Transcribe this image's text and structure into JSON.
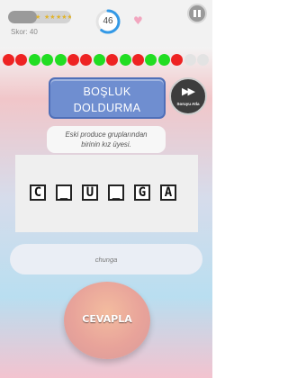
{
  "header": {
    "stars_fraction": 0.45,
    "score_text": "Skor: 40",
    "timer_value": "46",
    "timer_fraction": 0.6,
    "star_labels": [
      "★",
      "★★",
      "★★★"
    ],
    "heart_icon": "♥"
  },
  "progress": {
    "states": [
      "red",
      "red",
      "green",
      "green",
      "green",
      "red",
      "red",
      "green",
      "red",
      "green",
      "red",
      "green",
      "green",
      "red",
      "gray",
      "gray"
    ],
    "colors": {
      "red": "#ee2222",
      "green": "#22dd22",
      "gray": "#e3e3e3"
    }
  },
  "category": {
    "line1": "BOŞLUK",
    "line2": "DOLDURMA"
  },
  "skip_button": {
    "icon": "▶▶",
    "label": "Soruyu Atla"
  },
  "hint": {
    "line1": "Eski produce gruplarından",
    "line2": "birinin kız üyesi."
  },
  "puzzle": {
    "tiles": [
      "C",
      "_",
      "U",
      "_",
      "G",
      "A"
    ]
  },
  "answer": {
    "value": "chunga"
  },
  "submit": {
    "label": "CEVAPLA"
  }
}
